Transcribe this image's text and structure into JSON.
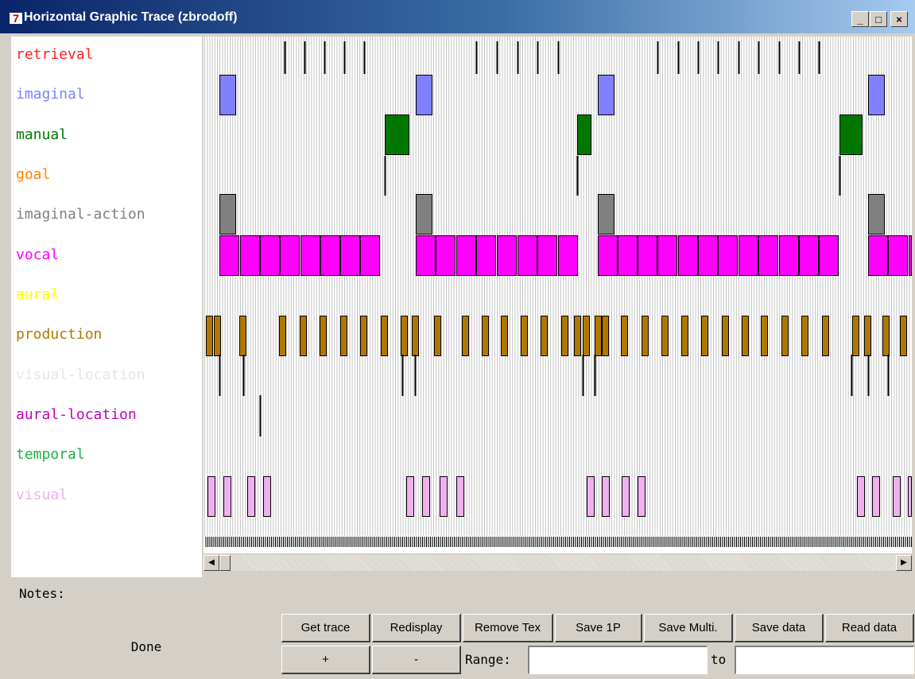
{
  "window": {
    "title": "Horizontal Graphic Trace (zbrodoff)",
    "app_icon": "tk-feather-icon",
    "controls": [
      "_",
      "□",
      "×"
    ]
  },
  "buffers": [
    {
      "name": "retrieval",
      "color": "#ff2020"
    },
    {
      "name": "imaginal",
      "color": "#8080ff"
    },
    {
      "name": "manual",
      "color": "#007800"
    },
    {
      "name": "goal",
      "color": "#ff8000"
    },
    {
      "name": "imaginal-action",
      "color": "#808080"
    },
    {
      "name": "vocal",
      "color": "#ff00ff"
    },
    {
      "name": "aural",
      "color": "#ffff00"
    },
    {
      "name": "production",
      "color": "#b07800"
    },
    {
      "name": "visual-location",
      "color": "#e6e6e6"
    },
    {
      "name": "aural-location",
      "color": "#c000c0"
    },
    {
      "name": "temporal",
      "color": "#20b040"
    },
    {
      "name": "visual",
      "color": "#f0b0f0"
    }
  ],
  "notes_label": "Notes:",
  "status": "Done",
  "buttons": {
    "get_trace": "Get trace",
    "redisplay": "Redisplay",
    "remove_text": "Remove Tex",
    "save_1p": "Save 1P",
    "save_multi": "Save Multi.",
    "save_data": "Save data",
    "read_data": "Read data",
    "plus": "+",
    "minus": "-"
  },
  "range": {
    "label": "Range:",
    "to_label": "to",
    "from_value": "",
    "to_value": ""
  }
}
